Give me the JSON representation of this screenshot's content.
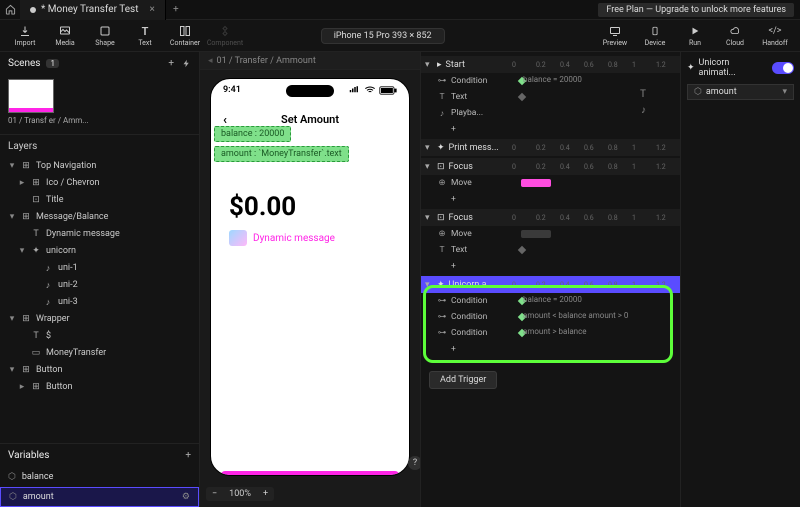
{
  "topbar": {
    "tab_title": "* Money Transfer Test",
    "upgrade": "Free Plan — Upgrade to unlock more features"
  },
  "toolbar": {
    "import": "Import",
    "media": "Media",
    "shape": "Shape",
    "text": "Text",
    "container": "Container",
    "component": "Component",
    "device": "iPhone 15 Pro  393 × 852",
    "preview": "Preview",
    "device_r": "Device",
    "run": "Run",
    "cloud": "Cloud",
    "handoff": "Handoff"
  },
  "left": {
    "scenes": "Scenes",
    "scenes_count": "1",
    "thumb_label": "01 / Transf\ner / Amm...",
    "layers": "Layers",
    "tree": {
      "top_nav": "Top Navigation",
      "ico_chevron": "Ico / Chevron",
      "title": "Title",
      "msg_balance": "Message/Balance",
      "dyn_msg": "Dynamic message",
      "unicorn": "unicorn",
      "uni1": "uni-1",
      "uni2": "uni-2",
      "uni3": "uni-3",
      "wrapper": "Wrapper",
      "dollar": "$",
      "money_transfer": "MoneyTransfer",
      "button": "Button",
      "button2": "Button"
    },
    "variables": "Variables",
    "var_balance": "balance",
    "var_amount": "amount"
  },
  "canvas": {
    "breadcrumb": "01 / Transfer / Ammount",
    "time": "9:41",
    "screen_title": "Set Amount",
    "pill1": "balance : 20000",
    "pill2": "amount : `MoneyTransfer`.text",
    "big_amount": "$0.00",
    "dynamic_msg": "Dynamic message",
    "zoom": "100%",
    "help": "?"
  },
  "timeline": {
    "ruler": [
      "0",
      "0.2",
      "0.4",
      "0.6",
      "0.8",
      "1",
      "1.2"
    ],
    "groups": [
      {
        "label": "Start",
        "rows": [
          {
            "kind": "cond",
            "label": "Condition",
            "value": "balance = 20000"
          },
          {
            "kind": "text",
            "label": "Text"
          },
          {
            "kind": "play",
            "label": "Playba..."
          },
          {
            "kind": "add",
            "label": "+"
          }
        ]
      },
      {
        "label": "Print mess...",
        "rows": []
      },
      {
        "label": "Focus",
        "rows": [
          {
            "kind": "move",
            "label": "Move",
            "seg": true
          },
          {
            "kind": "add",
            "label": "+"
          }
        ]
      },
      {
        "label": "Focus",
        "rows": [
          {
            "kind": "move",
            "label": "Move",
            "seg_gray": true
          },
          {
            "kind": "text",
            "label": "Text"
          },
          {
            "kind": "add",
            "label": "+"
          }
        ]
      },
      {
        "label": "Unicorn a...",
        "highlight": true,
        "rows": [
          {
            "kind": "cond",
            "label": "Condition",
            "value": "balance = 20000"
          },
          {
            "kind": "cond",
            "label": "Condition",
            "value": "amount < balance      amount > 0"
          },
          {
            "kind": "cond",
            "label": "Condition",
            "value": "amount > balance"
          },
          {
            "kind": "add",
            "label": "+"
          }
        ]
      }
    ],
    "add_trigger": "Add Trigger"
  },
  "far_right": {
    "title": "Unicorn animati...",
    "var": "amount"
  }
}
